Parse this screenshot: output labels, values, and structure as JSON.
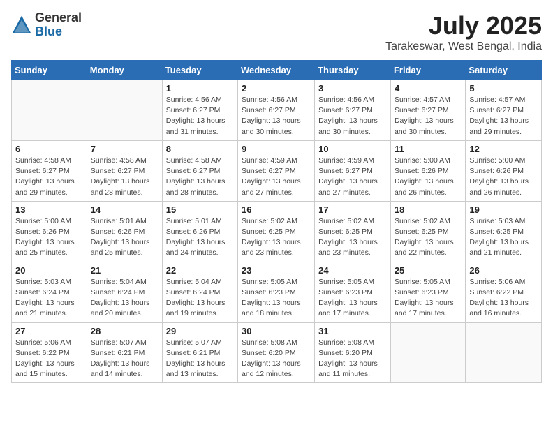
{
  "logo": {
    "general": "General",
    "blue": "Blue"
  },
  "title": {
    "month_year": "July 2025",
    "location": "Tarakeswar, West Bengal, India"
  },
  "weekdays": [
    "Sunday",
    "Monday",
    "Tuesday",
    "Wednesday",
    "Thursday",
    "Friday",
    "Saturday"
  ],
  "weeks": [
    [
      {
        "day": "",
        "info": ""
      },
      {
        "day": "",
        "info": ""
      },
      {
        "day": "1",
        "info": "Sunrise: 4:56 AM\nSunset: 6:27 PM\nDaylight: 13 hours and 31 minutes."
      },
      {
        "day": "2",
        "info": "Sunrise: 4:56 AM\nSunset: 6:27 PM\nDaylight: 13 hours and 30 minutes."
      },
      {
        "day": "3",
        "info": "Sunrise: 4:56 AM\nSunset: 6:27 PM\nDaylight: 13 hours and 30 minutes."
      },
      {
        "day": "4",
        "info": "Sunrise: 4:57 AM\nSunset: 6:27 PM\nDaylight: 13 hours and 30 minutes."
      },
      {
        "day": "5",
        "info": "Sunrise: 4:57 AM\nSunset: 6:27 PM\nDaylight: 13 hours and 29 minutes."
      }
    ],
    [
      {
        "day": "6",
        "info": "Sunrise: 4:58 AM\nSunset: 6:27 PM\nDaylight: 13 hours and 29 minutes."
      },
      {
        "day": "7",
        "info": "Sunrise: 4:58 AM\nSunset: 6:27 PM\nDaylight: 13 hours and 28 minutes."
      },
      {
        "day": "8",
        "info": "Sunrise: 4:58 AM\nSunset: 6:27 PM\nDaylight: 13 hours and 28 minutes."
      },
      {
        "day": "9",
        "info": "Sunrise: 4:59 AM\nSunset: 6:27 PM\nDaylight: 13 hours and 27 minutes."
      },
      {
        "day": "10",
        "info": "Sunrise: 4:59 AM\nSunset: 6:27 PM\nDaylight: 13 hours and 27 minutes."
      },
      {
        "day": "11",
        "info": "Sunrise: 5:00 AM\nSunset: 6:26 PM\nDaylight: 13 hours and 26 minutes."
      },
      {
        "day": "12",
        "info": "Sunrise: 5:00 AM\nSunset: 6:26 PM\nDaylight: 13 hours and 26 minutes."
      }
    ],
    [
      {
        "day": "13",
        "info": "Sunrise: 5:00 AM\nSunset: 6:26 PM\nDaylight: 13 hours and 25 minutes."
      },
      {
        "day": "14",
        "info": "Sunrise: 5:01 AM\nSunset: 6:26 PM\nDaylight: 13 hours and 25 minutes."
      },
      {
        "day": "15",
        "info": "Sunrise: 5:01 AM\nSunset: 6:26 PM\nDaylight: 13 hours and 24 minutes."
      },
      {
        "day": "16",
        "info": "Sunrise: 5:02 AM\nSunset: 6:25 PM\nDaylight: 13 hours and 23 minutes."
      },
      {
        "day": "17",
        "info": "Sunrise: 5:02 AM\nSunset: 6:25 PM\nDaylight: 13 hours and 23 minutes."
      },
      {
        "day": "18",
        "info": "Sunrise: 5:02 AM\nSunset: 6:25 PM\nDaylight: 13 hours and 22 minutes."
      },
      {
        "day": "19",
        "info": "Sunrise: 5:03 AM\nSunset: 6:25 PM\nDaylight: 13 hours and 21 minutes."
      }
    ],
    [
      {
        "day": "20",
        "info": "Sunrise: 5:03 AM\nSunset: 6:24 PM\nDaylight: 13 hours and 21 minutes."
      },
      {
        "day": "21",
        "info": "Sunrise: 5:04 AM\nSunset: 6:24 PM\nDaylight: 13 hours and 20 minutes."
      },
      {
        "day": "22",
        "info": "Sunrise: 5:04 AM\nSunset: 6:24 PM\nDaylight: 13 hours and 19 minutes."
      },
      {
        "day": "23",
        "info": "Sunrise: 5:05 AM\nSunset: 6:23 PM\nDaylight: 13 hours and 18 minutes."
      },
      {
        "day": "24",
        "info": "Sunrise: 5:05 AM\nSunset: 6:23 PM\nDaylight: 13 hours and 17 minutes."
      },
      {
        "day": "25",
        "info": "Sunrise: 5:05 AM\nSunset: 6:23 PM\nDaylight: 13 hours and 17 minutes."
      },
      {
        "day": "26",
        "info": "Sunrise: 5:06 AM\nSunset: 6:22 PM\nDaylight: 13 hours and 16 minutes."
      }
    ],
    [
      {
        "day": "27",
        "info": "Sunrise: 5:06 AM\nSunset: 6:22 PM\nDaylight: 13 hours and 15 minutes."
      },
      {
        "day": "28",
        "info": "Sunrise: 5:07 AM\nSunset: 6:21 PM\nDaylight: 13 hours and 14 minutes."
      },
      {
        "day": "29",
        "info": "Sunrise: 5:07 AM\nSunset: 6:21 PM\nDaylight: 13 hours and 13 minutes."
      },
      {
        "day": "30",
        "info": "Sunrise: 5:08 AM\nSunset: 6:20 PM\nDaylight: 13 hours and 12 minutes."
      },
      {
        "day": "31",
        "info": "Sunrise: 5:08 AM\nSunset: 6:20 PM\nDaylight: 13 hours and 11 minutes."
      },
      {
        "day": "",
        "info": ""
      },
      {
        "day": "",
        "info": ""
      }
    ]
  ]
}
